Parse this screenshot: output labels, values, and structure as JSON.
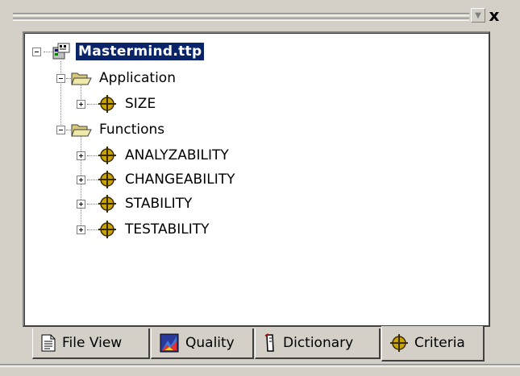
{
  "window": {
    "minimize_glyph": "▼",
    "close_glyph": "x"
  },
  "tree": {
    "root": {
      "label": "Mastermind.ttp",
      "icon": "project-icon",
      "selected": true,
      "expanded": true
    },
    "folders": [
      {
        "label": "Application",
        "icon": "folder-open-icon",
        "expanded": true,
        "children": [
          {
            "label": "SIZE",
            "icon": "criteria-icon",
            "expanded": false
          }
        ]
      },
      {
        "label": "Functions",
        "icon": "folder-open-icon",
        "expanded": true,
        "children": [
          {
            "label": "ANALYZABILITY",
            "icon": "criteria-icon",
            "expanded": false
          },
          {
            "label": "CHANGEABILITY",
            "icon": "criteria-icon",
            "expanded": false
          },
          {
            "label": "STABILITY",
            "icon": "criteria-icon",
            "expanded": false
          },
          {
            "label": "TESTABILITY",
            "icon": "criteria-icon",
            "expanded": false
          }
        ]
      }
    ]
  },
  "tabs": [
    {
      "label": "File View",
      "icon": "document-icon",
      "active": false
    },
    {
      "label": "Quality",
      "icon": "quality-icon",
      "active": false
    },
    {
      "label": "Dictionary",
      "icon": "dictionary-icon",
      "active": false
    },
    {
      "label": "Criteria",
      "icon": "criteria-icon",
      "active": true
    }
  ],
  "colors": {
    "face": "#d4d0c8",
    "selection": "#0a246a",
    "criteria_fill": "#c9a400"
  }
}
